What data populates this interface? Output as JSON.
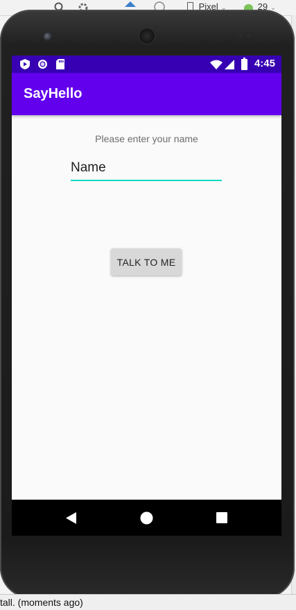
{
  "ide": {
    "toolbar": {
      "device_label": "Pixel",
      "api_label": "29",
      "search_icon": "search-icon",
      "settings_icon": "gear-icon"
    },
    "status_text": "tall. (moments ago)"
  },
  "device": {
    "status_bar": {
      "time": "4:45",
      "icons": [
        "play-protect-icon",
        "circle-notification-icon",
        "sd-card-icon",
        "wifi-icon",
        "signal-icon",
        "battery-icon"
      ],
      "color": "#3700b3"
    },
    "app_bar": {
      "title": "SayHello",
      "color": "#6200ee"
    },
    "content": {
      "prompt": "Please enter your name",
      "name_field": {
        "placeholder": "Name",
        "value": "",
        "underline_color": "#03dac5"
      },
      "talk_button_label": "TALK TO ME"
    },
    "nav_bar": {
      "buttons": [
        "back-icon",
        "home-icon",
        "recents-icon"
      ]
    }
  }
}
